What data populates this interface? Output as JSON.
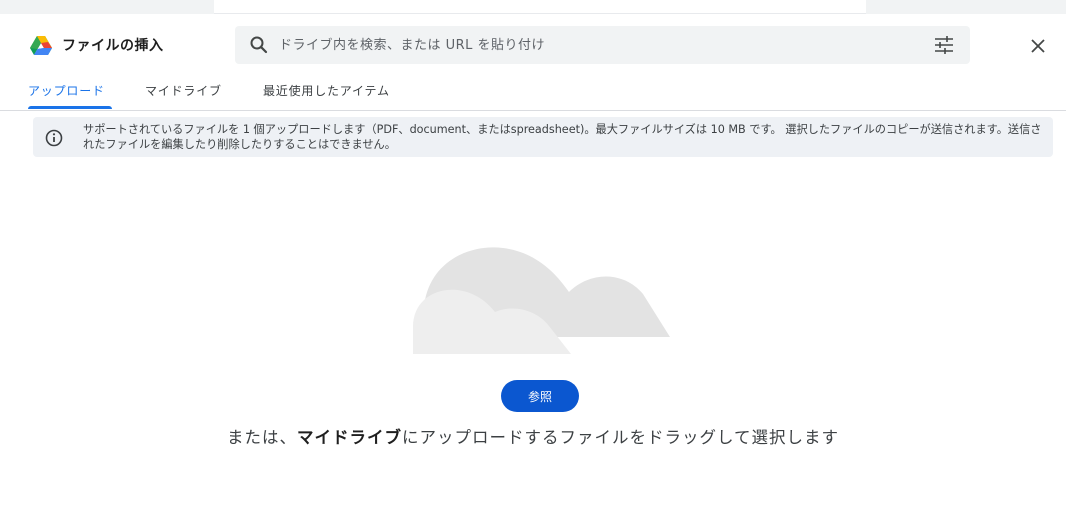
{
  "dialog": {
    "title": "ファイルの挿入",
    "close_label": "×"
  },
  "search": {
    "placeholder": "ドライブ内を検索、または URL を貼り付け",
    "value": ""
  },
  "tabs": [
    {
      "label": "アップロード",
      "active": true
    },
    {
      "label": "マイドライブ",
      "active": false
    },
    {
      "label": "最近使用したアイテム",
      "active": false
    }
  ],
  "info_banner": {
    "text": "サポートされているファイルを 1 個アップロードします（PDF、document、またはspreadsheet)。最大ファイルサイズは 10 MB です。 選択したファイルのコピーが送信されます。送信されたファイルを編集したり削除したりすることはできません。"
  },
  "upload": {
    "browse_label": "参照",
    "drag_prefix": "または、",
    "drag_bold": "マイドライブ",
    "drag_suffix": "にアップロードするファイルをドラッグして選択します"
  },
  "colors": {
    "accent": "#1a73e8",
    "button": "#0b57d0",
    "banner_bg": "#eef1f5",
    "search_bg": "#f1f3f4"
  },
  "icons": {
    "logo": "google-drive-logo",
    "search": "search-icon",
    "filter": "tune-icon",
    "close": "close-icon",
    "info": "info-icon",
    "illustration": "cloud-illustration"
  }
}
